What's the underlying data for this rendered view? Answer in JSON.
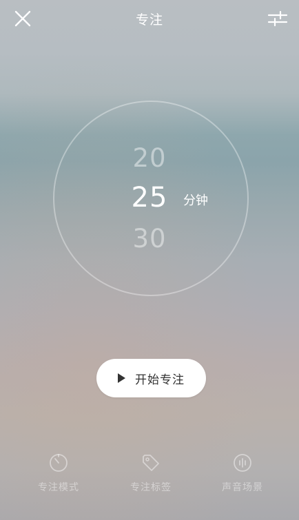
{
  "header": {
    "title": "专注"
  },
  "picker": {
    "prev_value": "20",
    "current_value": "25",
    "next_value": "30",
    "unit": "分钟"
  },
  "start_button": {
    "label": "开始专注"
  },
  "bottom_nav": {
    "items": [
      {
        "label": "专注模式",
        "icon": "timer-icon"
      },
      {
        "label": "专注标签",
        "icon": "tag-icon"
      },
      {
        "label": "声音场景",
        "icon": "sound-wave-icon"
      }
    ]
  },
  "colors": {
    "text_primary": "#ffffff",
    "text_muted": "rgba(255,255,255,0.45)",
    "button_bg": "#ffffff",
    "button_text": "#333333"
  }
}
